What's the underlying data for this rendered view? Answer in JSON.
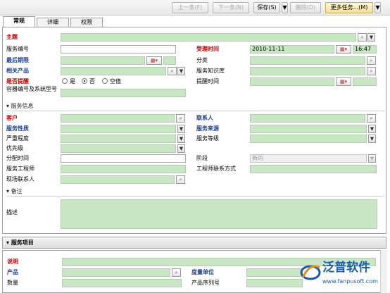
{
  "toolbar": {
    "prev": "上一条(F)",
    "next": "下一条(N)",
    "save": "保存(S)",
    "delete": "删除(D)",
    "more": "更多任务...(M)",
    "dropdown": "▼"
  },
  "tabs": [
    "常规",
    "详细",
    "权限"
  ],
  "form": {
    "subject": "主题",
    "service_no": "服务编号",
    "accept_time": "受理时间",
    "accept_date": "2010-11-11",
    "accept_clock": "16:47",
    "deadline": "最后期限",
    "category": "分类",
    "related_product": "相关产品",
    "knowledge_base": "服务知识库",
    "remind": "是否提醒",
    "remind_yes": "是",
    "remind_no": "否",
    "remind_empty": "空值",
    "remind_time": "提醒时间",
    "container_no": "容器编号及系统型号"
  },
  "service_info": {
    "header": "服务信息",
    "customer": "客户",
    "contact": "联系人",
    "nature": "服务性质",
    "source": "服务来源",
    "severity": "严重程度",
    "level": "服务等级",
    "priority": "优先级",
    "assign_time": "分配时间",
    "stage": "阶段",
    "stage_value": "新的",
    "engineer": "服务工程师",
    "engineer_contact": "工程师联系方式",
    "site_contact": "现场联系人"
  },
  "notes": {
    "header": "备注",
    "description": "描述"
  },
  "items": {
    "header": "服务项目",
    "note": "说明",
    "product": "产品",
    "unit": "度量单位",
    "quantity": "数量",
    "serial": "产品序列号"
  },
  "logo": {
    "name": "泛普软件",
    "url": "www.fanpusoft.com"
  },
  "colors": {
    "field_green": "#c9e7c4",
    "label_red": "#c00000",
    "label_blue": "#1f3f8f",
    "logo_blue": "#1a5ca8"
  }
}
